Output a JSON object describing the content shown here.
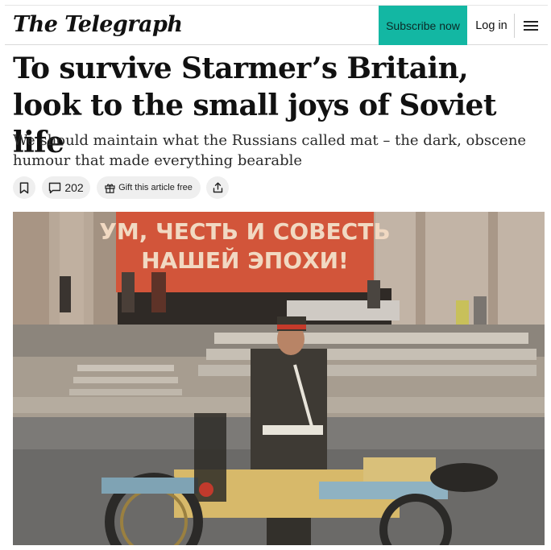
{
  "header": {
    "masthead": "The Telegraph",
    "subscribe_label": "Subscribe now",
    "login_label": "Log in",
    "menu_icon": "hamburger-menu-icon",
    "subscribe_color": "#13b7a3"
  },
  "article": {
    "headline": "To survive Starmer’s Britain, look to the small joys of Soviet life",
    "standfirst": "We should maintain what the Russians called mat – the dark, obscene humour that made everything bearable",
    "actions": {
      "bookmark_icon": "bookmark-icon",
      "comment_count": "202",
      "comment_icon": "comment-icon",
      "gift_label": "Gift this article free",
      "gift_icon": "gift-icon",
      "share_icon": "share-icon"
    },
    "image": {
      "banner_line1": "УМ, ЧЕСТЬ И СОВЕСТЬ",
      "banner_line2": "НАШЕЙ ЭПОХИ!",
      "banner_color": "#d2553a"
    }
  }
}
